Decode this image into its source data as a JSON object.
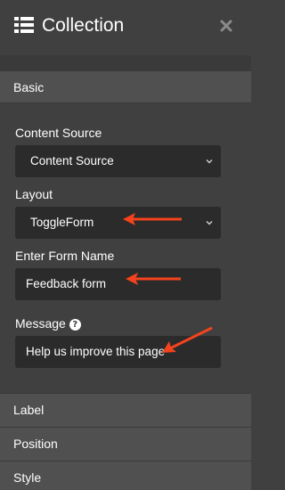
{
  "panel": {
    "title": "Collection",
    "header_icon": "list-icon",
    "close_icon": "close-icon"
  },
  "sections": {
    "basic": "Basic",
    "label": "Label",
    "position": "Position",
    "style": "Style"
  },
  "fields": {
    "content_source": {
      "label": "Content Source",
      "value": "Content Source"
    },
    "layout": {
      "label": "Layout",
      "value": "ToggleForm"
    },
    "form_name": {
      "label": "Enter Form Name",
      "value": "Feedback form"
    },
    "message": {
      "label": "Message",
      "value": "Help us improve this page",
      "help_icon": "help-icon"
    }
  },
  "colors": {
    "panel_bg": "#404040",
    "section_bg": "#505050",
    "input_bg": "#2b2b2b",
    "annotation_arrow": "#f4431c"
  }
}
